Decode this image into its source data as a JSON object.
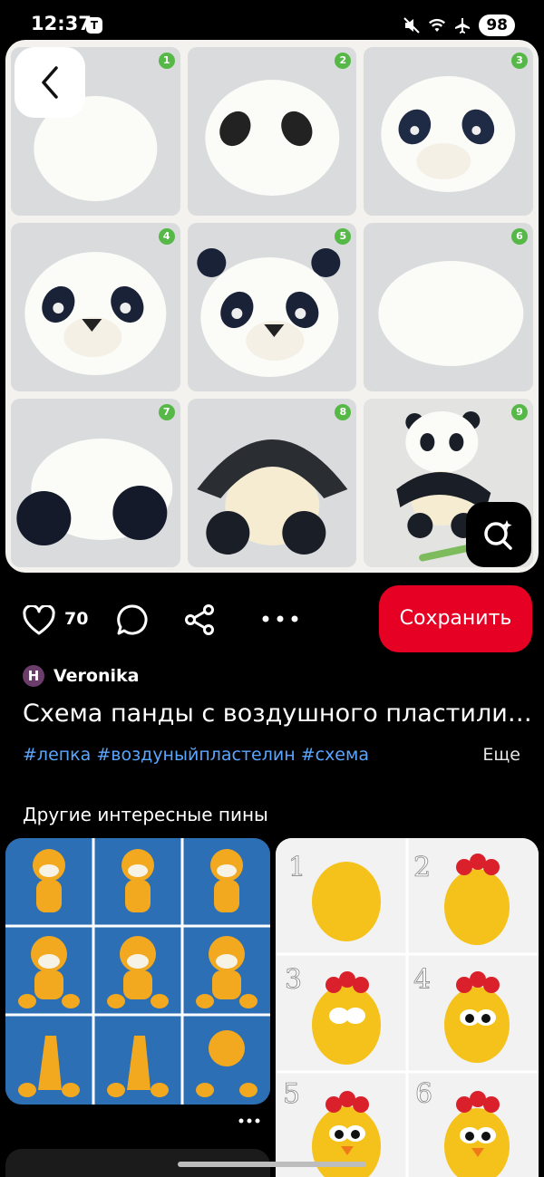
{
  "status": {
    "time": "12:37",
    "carrier_badge": "T",
    "battery": "98",
    "icons": [
      "mute-icon",
      "wifi-icon",
      "airplane-icon",
      "battery-charging-icon"
    ]
  },
  "pin": {
    "step_numbers": [
      "1",
      "2",
      "3",
      "4",
      "5",
      "6",
      "7",
      "8",
      "9"
    ],
    "back_icon": "chevron-left-icon",
    "lens_icon": "visual-search-icon"
  },
  "actions": {
    "like_count": "70",
    "save_label": "Сохранить"
  },
  "author": {
    "initial": "H",
    "name": "Veronika"
  },
  "title": "Схема панды с воздушного пластили…",
  "tags": "#лепка #воздуныйпластелин #схема",
  "more_label": "Еще",
  "related": {
    "section_title": "Другие интересные пины",
    "pin_right_numbers": [
      "1",
      "2",
      "3",
      "4",
      "5",
      "6"
    ]
  },
  "colors": {
    "save": "#e60023",
    "tags": "#5aa6ff",
    "step_badge": "#56b947"
  }
}
